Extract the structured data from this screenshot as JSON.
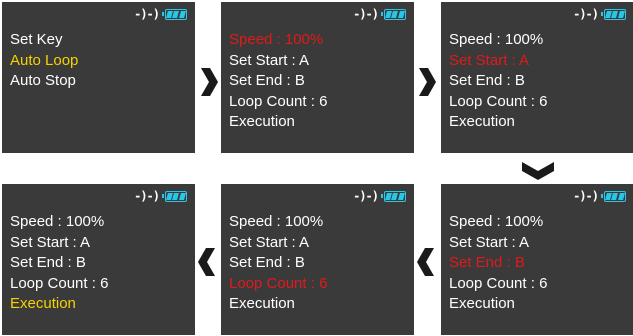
{
  "status_bar": {
    "loop_indicator": "-)-)",
    "battery_icon": "battery-icon",
    "battery_level": 1.0
  },
  "colors": {
    "screen_bg": "#3a3a3a",
    "text": "#ffffff",
    "highlight_red": "#e01a1a",
    "highlight_yellow": "#f5d200",
    "battery": "#29c6e8",
    "chevron": "#1a1a1a"
  },
  "screens": [
    {
      "items": [
        {
          "label": "Set Key",
          "state": "normal"
        },
        {
          "label": "Auto Loop",
          "state": "selected"
        },
        {
          "label": "Auto Stop",
          "state": "normal"
        }
      ]
    },
    {
      "items": [
        {
          "label": "Speed : 100%",
          "state": "editing"
        },
        {
          "label": "Set Start : A",
          "state": "normal"
        },
        {
          "label": "Set End : B",
          "state": "normal"
        },
        {
          "label": "Loop Count : 6",
          "state": "normal"
        },
        {
          "label": "Execution",
          "state": "normal"
        }
      ]
    },
    {
      "items": [
        {
          "label": "Speed : 100%",
          "state": "normal"
        },
        {
          "label": "Set Start : A",
          "state": "editing"
        },
        {
          "label": "Set End : B",
          "state": "normal"
        },
        {
          "label": "Loop Count : 6",
          "state": "normal"
        },
        {
          "label": "Execution",
          "state": "normal"
        }
      ]
    },
    {
      "items": [
        {
          "label": "Speed : 100%",
          "state": "normal"
        },
        {
          "label": "Set Start : A",
          "state": "normal"
        },
        {
          "label": "Set End : B",
          "state": "editing"
        },
        {
          "label": "Loop Count : 6",
          "state": "normal"
        },
        {
          "label": "Execution",
          "state": "normal"
        }
      ]
    },
    {
      "items": [
        {
          "label": "Speed : 100%",
          "state": "normal"
        },
        {
          "label": "Set Start : A",
          "state": "normal"
        },
        {
          "label": "Set End : B",
          "state": "normal"
        },
        {
          "label": "Loop Count : 6",
          "state": "editing"
        },
        {
          "label": "Execution",
          "state": "normal"
        }
      ]
    },
    {
      "items": [
        {
          "label": "Speed : 100%",
          "state": "normal"
        },
        {
          "label": "Set Start : A",
          "state": "normal"
        },
        {
          "label": "Set End : B",
          "state": "normal"
        },
        {
          "label": "Loop Count : 6",
          "state": "normal"
        },
        {
          "label": "Execution",
          "state": "selected"
        }
      ]
    }
  ],
  "flow_arrows": [
    "chevron-right-icon",
    "chevron-right-icon",
    "chevron-down-icon",
    "chevron-left-icon",
    "chevron-left-icon"
  ]
}
